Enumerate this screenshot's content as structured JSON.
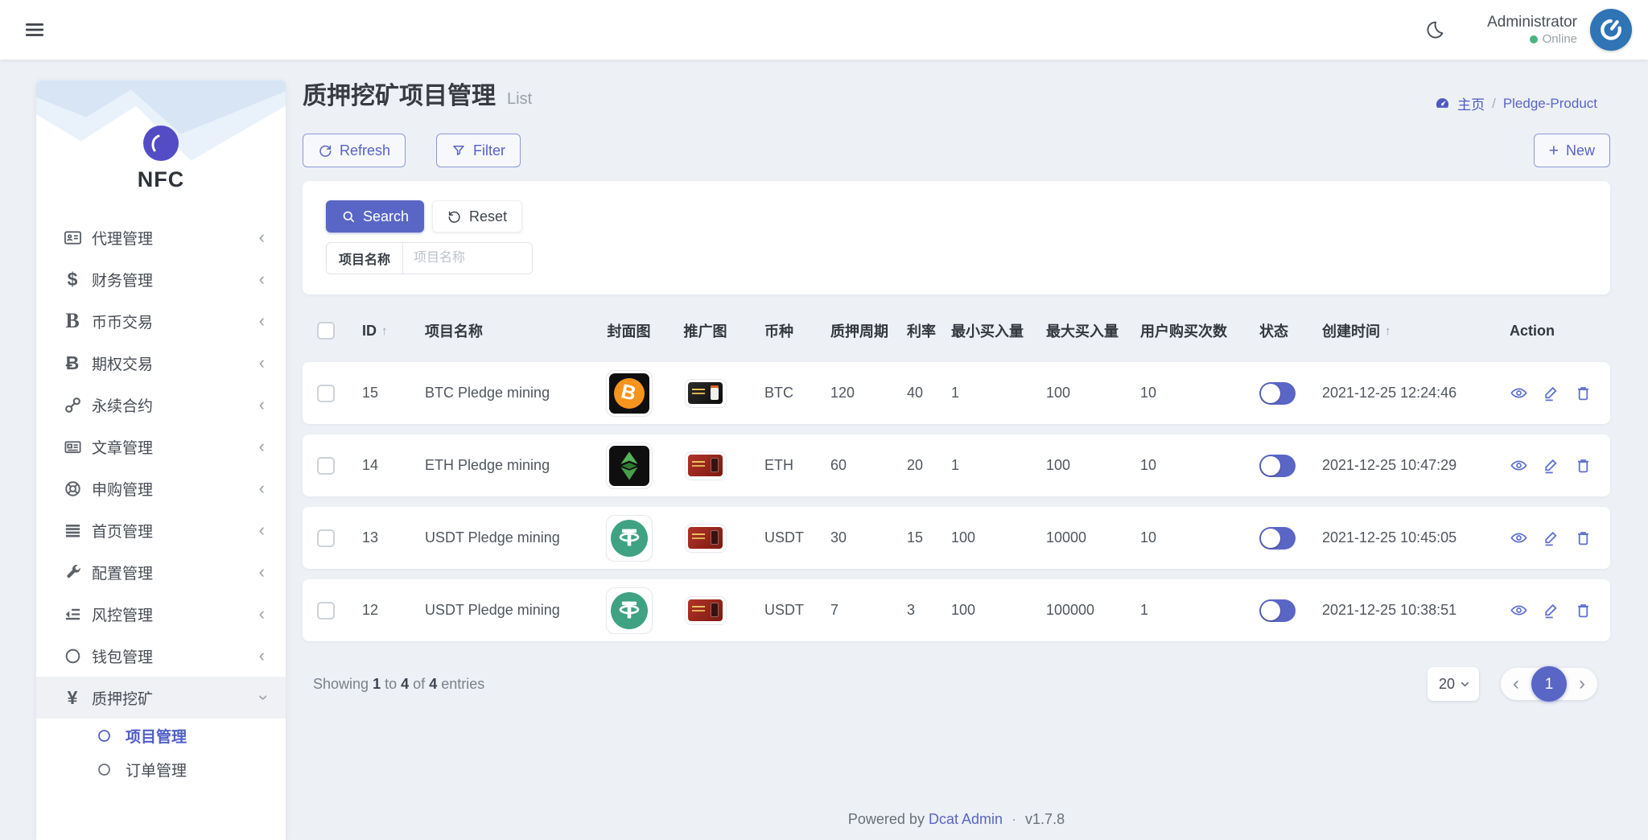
{
  "colors": {
    "primary": "#5a66c5",
    "avatar_bg": "#2f74b5",
    "online_green": "#4ab47f",
    "page_bg": "#edf0f5"
  },
  "topbar": {
    "user_name": "Administrator",
    "user_status": "Online"
  },
  "sidebar": {
    "brand": "NFC",
    "items": [
      {
        "label": "代理管理",
        "icon": "id-card-icon",
        "expanded": false
      },
      {
        "label": "财务管理",
        "icon": "dollar-icon",
        "expanded": false
      },
      {
        "label": "币币交易",
        "icon": "coin-b-icon",
        "expanded": false
      },
      {
        "label": "期权交易",
        "icon": "bitcoin-icon",
        "expanded": false
      },
      {
        "label": "永续合约",
        "icon": "link-icon",
        "expanded": false
      },
      {
        "label": "文章管理",
        "icon": "newspaper-icon",
        "expanded": false
      },
      {
        "label": "申购管理",
        "icon": "life-ring-icon",
        "expanded": false
      },
      {
        "label": "首页管理",
        "icon": "list-icon",
        "expanded": false
      },
      {
        "label": "配置管理",
        "icon": "wrench-icon",
        "expanded": false
      },
      {
        "label": "风控管理",
        "icon": "indent-list-icon",
        "expanded": false
      },
      {
        "label": "钱包管理",
        "icon": "circle-icon",
        "expanded": false
      },
      {
        "label": "质押挖矿",
        "icon": "yen-icon",
        "expanded": true
      }
    ],
    "submenu": [
      {
        "label": "项目管理",
        "icon": "dot-circle-icon",
        "active": true
      },
      {
        "label": "订单管理",
        "icon": "dot-circle-icon",
        "active": false
      }
    ]
  },
  "page_header": {
    "title": "质押挖矿项目管理",
    "subtitle": "List",
    "breadcrumb_home": "主页",
    "breadcrumb_sep": "/",
    "breadcrumb_current": "Pledge-Product"
  },
  "toolbar": {
    "refresh_label": "Refresh",
    "filter_label": "Filter",
    "new_label": "New"
  },
  "filter_panel": {
    "search_label": "Search",
    "reset_label": "Reset",
    "field_label": "项目名称",
    "field_placeholder": "项目名称"
  },
  "table": {
    "columns": [
      "ID",
      "项目名称",
      "封面图",
      "推广图",
      "币种",
      "质押周期",
      "利率",
      "最小买入量",
      "最大买入量",
      "用户购买次数",
      "状态",
      "创建时间",
      "Action"
    ],
    "sorted_columns": [
      "ID",
      "创建时间"
    ],
    "rows": [
      {
        "id": "15",
        "name": "BTC Pledge mining",
        "cover": "btc",
        "promo": "dark",
        "coin": "BTC",
        "period": "120",
        "rate": "40",
        "min_buy": "1",
        "max_buy": "100",
        "buy_times": "10",
        "status_on": true,
        "created_at": "2021-12-25 12:24:46"
      },
      {
        "id": "14",
        "name": "ETH Pledge mining",
        "cover": "eth",
        "promo": "red",
        "coin": "ETH",
        "period": "60",
        "rate": "20",
        "min_buy": "1",
        "max_buy": "100",
        "buy_times": "10",
        "status_on": true,
        "created_at": "2021-12-25 10:47:29"
      },
      {
        "id": "13",
        "name": "USDT Pledge mining",
        "cover": "usdt",
        "promo": "red",
        "coin": "USDT",
        "period": "30",
        "rate": "15",
        "min_buy": "100",
        "max_buy": "10000",
        "buy_times": "10",
        "status_on": true,
        "created_at": "2021-12-25 10:45:05"
      },
      {
        "id": "12",
        "name": "USDT Pledge mining",
        "cover": "usdt",
        "promo": "red",
        "coin": "USDT",
        "period": "7",
        "rate": "3",
        "min_buy": "100",
        "max_buy": "100000",
        "buy_times": "1",
        "status_on": true,
        "created_at": "2021-12-25 10:38:51"
      }
    ]
  },
  "table_footer": {
    "showing_prefix": "Showing",
    "showing_from": "1",
    "word_to": "to",
    "showing_to": "4",
    "word_of": "of",
    "showing_total": "4",
    "showing_suffix": "entries",
    "page_size": "20",
    "current_page": "1"
  },
  "footer": {
    "powered_text": "Powered by",
    "brand_link": "Dcat Admin",
    "dot": "·",
    "version": "v1.7.8"
  }
}
